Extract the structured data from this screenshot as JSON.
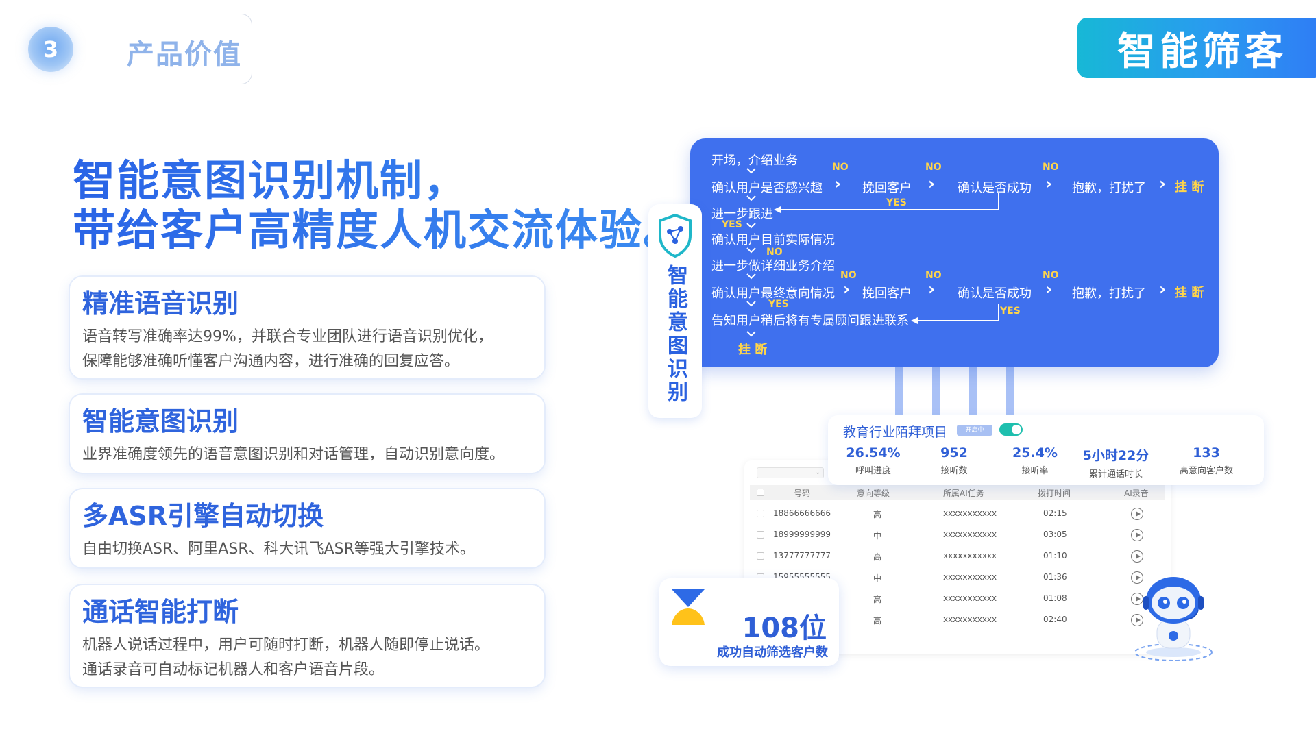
{
  "section": {
    "number": "3",
    "title": "产品价值"
  },
  "badge": {
    "label": "智能筛客"
  },
  "headline": {
    "line1": "智能意图识别机制，",
    "line2": "带给客户高精度人机交流体验。"
  },
  "features": [
    {
      "title": "精准语音识别",
      "line1": "语音转写准确率达99%，并联合专业团队进行语音识别优化，",
      "line2": "保障能够准确听懂客户沟通内容，进行准确的回复应答。"
    },
    {
      "title": "智能意图识别",
      "line1": "业界准确度领先的语音意图识别和对话管理，自动识别意向度。"
    },
    {
      "title": "多ASR引擎自动切换",
      "line1": "自由切换ASR、阿里ASR、科大讯飞ASR等强大引擎技术。"
    },
    {
      "title": "通话智能打断",
      "line1": "机器人说话过程中，用户可随时打断，机器人随即停止说话。",
      "line2": "通话录音可自动标记机器人和客户语音片段。"
    }
  ],
  "intent_panel": {
    "label": "智能意图识别"
  },
  "flow": {
    "start": "开场，介绍业务",
    "row1": [
      "确认用户是否感兴趣",
      "挽回客户",
      "确认是否成功",
      "抱歉，打扰了"
    ],
    "follow": "进一步跟进",
    "situation": "确认用户目前实际情况",
    "detail": "进一步做详细业务介绍",
    "row2": [
      "确认用户最终意向情况",
      "挽回客户",
      "确认是否成功",
      "抱歉，打扰了"
    ],
    "notify": "告知用户稍后将有专属顾问跟进联系",
    "hangup": "挂 断",
    "no": "NO",
    "yes": "YES"
  },
  "project": {
    "title": "教育行业陌拜项目",
    "status": "开启中",
    "stats": [
      {
        "value": "26.54%",
        "label": "呼叫进度"
      },
      {
        "value": "952",
        "label": "接听数"
      },
      {
        "value": "25.4%",
        "label": "接听率"
      },
      {
        "value": "5小时22分",
        "label": "累计通话时长"
      },
      {
        "value": "133",
        "label": "高意向客户数"
      }
    ]
  },
  "table": {
    "filter": "⌄",
    "headers": [
      "号码",
      "意向等级",
      "所属AI任务",
      "拨打时间",
      "AI录音"
    ],
    "rows": [
      {
        "phone": "18866666666",
        "level": "高",
        "task": "xxxxxxxxxxx",
        "time": "02:15"
      },
      {
        "phone": "18999999999",
        "level": "中",
        "task": "xxxxxxxxxxx",
        "time": "03:05"
      },
      {
        "phone": "13777777777",
        "level": "高",
        "task": "xxxxxxxxxxx",
        "time": "01:10"
      },
      {
        "phone": "15955555555",
        "level": "中",
        "task": "xxxxxxxxxxx",
        "time": "01:36"
      },
      {
        "phone": "",
        "level": "高",
        "task": "xxxxxxxxxxx",
        "time": "01:08"
      },
      {
        "phone": "",
        "level": "高",
        "task": "xxxxxxxxxxx",
        "time": "02:40"
      }
    ]
  },
  "count": {
    "value": "108位",
    "label": "成功自动筛选客户数"
  },
  "colors": {
    "brand": "#2f64dd",
    "flow_bg": "#3f70ee",
    "accent": "#ffd54a",
    "badge_start": "#17b8d6",
    "badge_end": "#2f7cf5"
  }
}
